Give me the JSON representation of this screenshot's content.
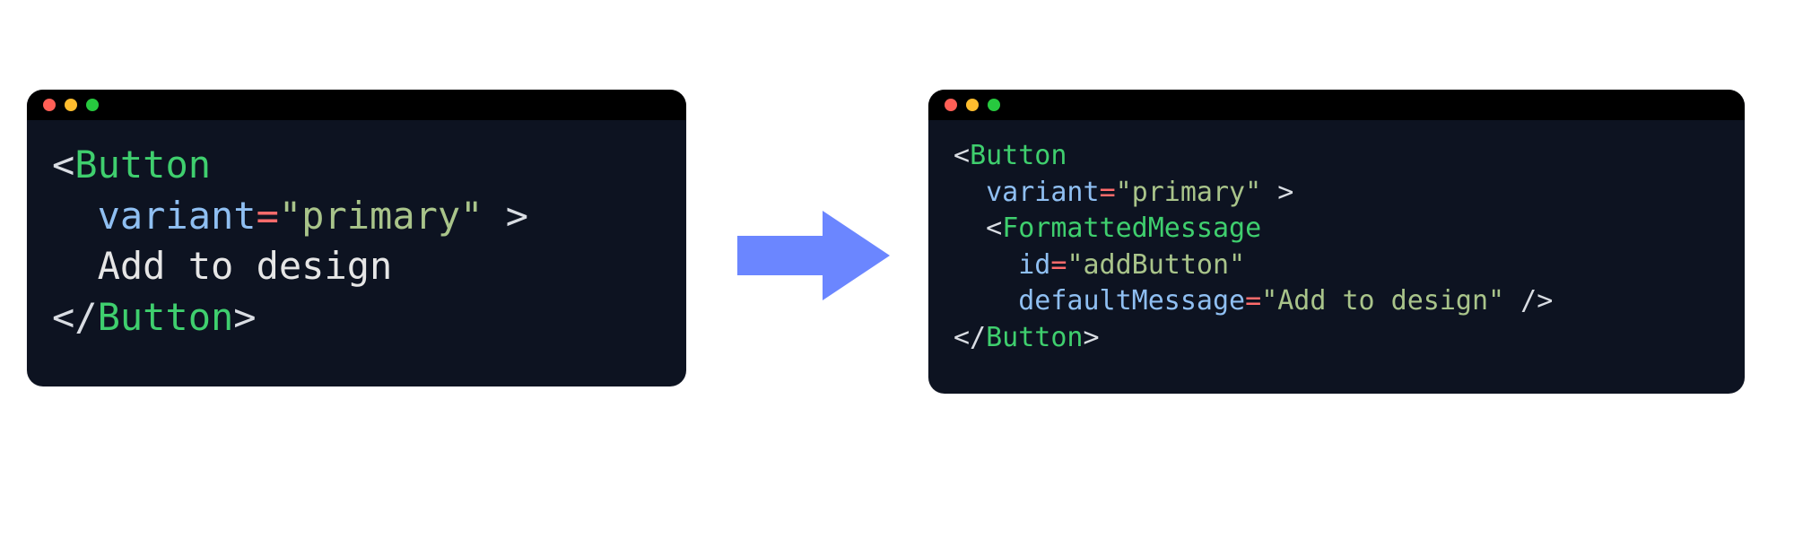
{
  "left": {
    "line1_open": "<",
    "line1_tag": "Button",
    "line2_attr": "variant",
    "line2_eq": "=",
    "line2_str": "\"primary\"",
    "line2_tail": " >",
    "line3_text": "Add to design",
    "line4_open": "</",
    "line4_tag": "Button",
    "line4_close": ">"
  },
  "right": {
    "l1_open": "<",
    "l1_tag": "Button",
    "l2_attr": "variant",
    "l2_eq": "=",
    "l2_str": "\"primary\"",
    "l2_tail": " >",
    "l3_open": "<",
    "l3_tag": "FormattedMessage",
    "l4_attr": "id",
    "l4_eq": "=",
    "l4_str": "\"addButton\"",
    "l5_attr": "defaultMessage",
    "l5_eq": "=",
    "l5_str": "\"Add to design\"",
    "l5_tail": " />",
    "l6_open": "</",
    "l6_tag": "Button",
    "l6_close": ">"
  },
  "colors": {
    "arrow": "#6b86ff",
    "window_bg": "#0d1321"
  }
}
